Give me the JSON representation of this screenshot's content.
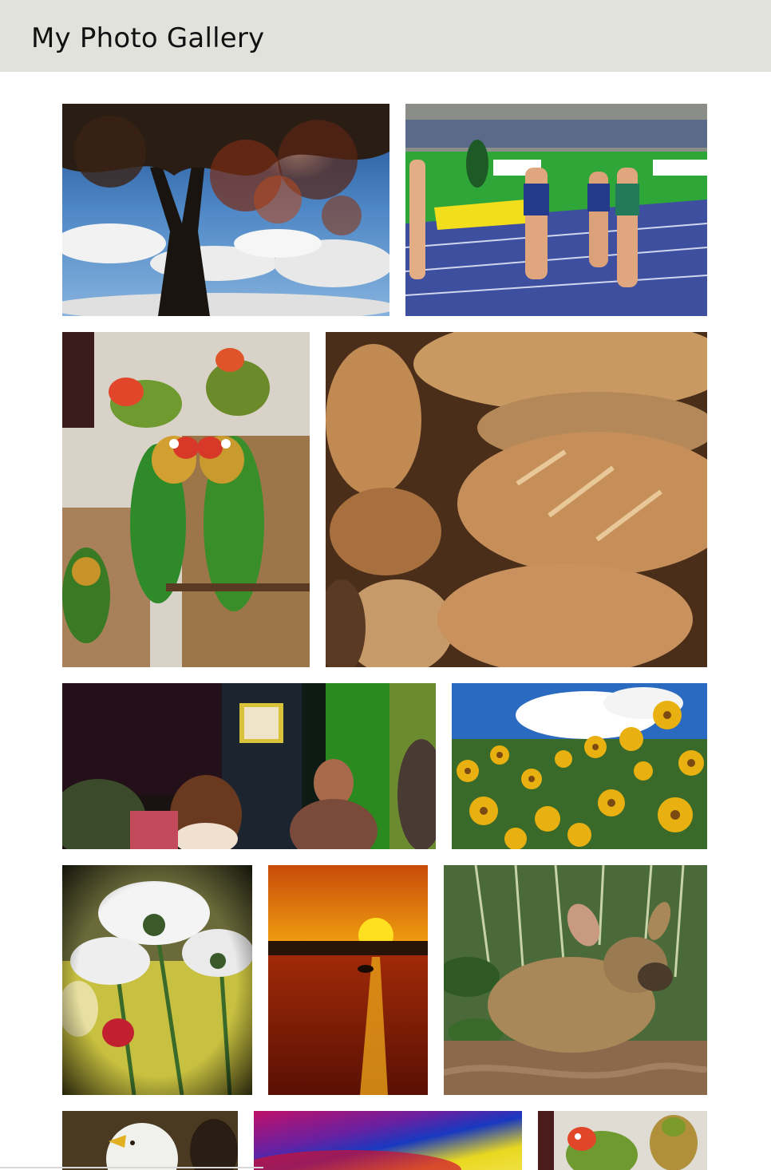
{
  "header": {
    "title": "My Photo Gallery",
    "background": "#e2e2dc"
  },
  "gallery": {
    "photos": [
      {
        "name": "photo-tree-sky",
        "subject": "tree against blue sky with clouds"
      },
      {
        "name": "photo-sprinters",
        "subject": "women sprinting on stadium track"
      },
      {
        "name": "photo-lovebirds",
        "subject": "pair of lovebirds on perch"
      },
      {
        "name": "photo-bread",
        "subject": "pile of bread loaves"
      },
      {
        "name": "photo-bar-people",
        "subject": "people sitting in a dim bar"
      },
      {
        "name": "photo-yellow-flowers",
        "subject": "yellow flowers under blue sky"
      },
      {
        "name": "photo-white-daisies",
        "subject": "white daisies from below"
      },
      {
        "name": "photo-sunset-sea",
        "subject": "sunset over water"
      },
      {
        "name": "photo-deer",
        "subject": "small deer lying in foliage"
      },
      {
        "name": "photo-eagle",
        "subject": "bald eagle"
      },
      {
        "name": "photo-abstract-color",
        "subject": "abstract colorful blur"
      },
      {
        "name": "photo-lovebirds-small",
        "subject": "lovebird in green"
      }
    ]
  }
}
